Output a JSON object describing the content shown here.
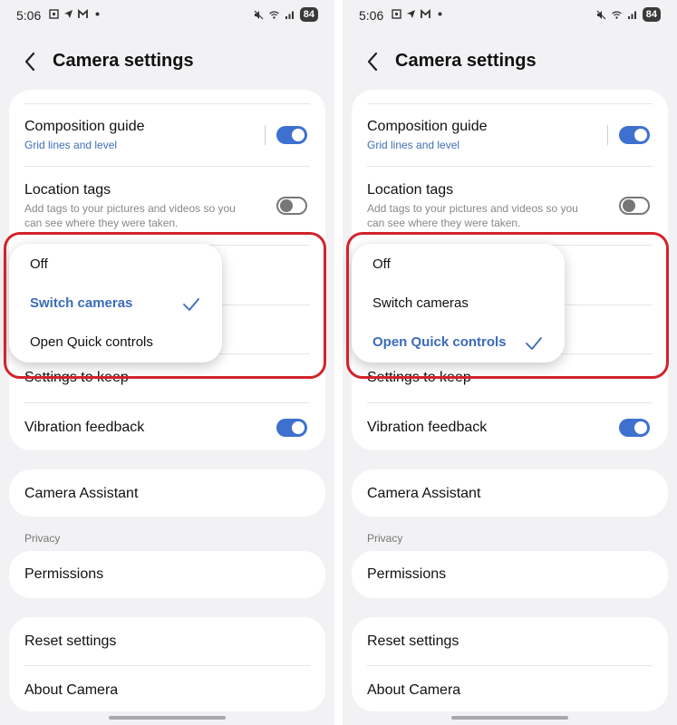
{
  "screens": [
    {
      "status": {
        "time": "5:06",
        "battery": "84"
      },
      "header": {
        "title": "Camera settings"
      },
      "settings": {
        "composition_title": "Composition guide",
        "composition_sub": "Grid lines and level",
        "composition_on": true,
        "location_title": "Location tags",
        "location_desc": "Add tags to your pictures and videos so you can see where they were taken.",
        "location_on": false,
        "keep_title": "Settings to keep",
        "vibration_title": "Vibration feedback",
        "vibration_on": true
      },
      "popup": {
        "options": [
          "Off",
          "Switch cameras",
          "Open Quick controls"
        ],
        "selected_index": 1
      },
      "assistant": "Camera Assistant",
      "privacy_label": "Privacy",
      "permissions": "Permissions",
      "reset": "Reset settings",
      "about": "About Camera"
    },
    {
      "status": {
        "time": "5:06",
        "battery": "84"
      },
      "header": {
        "title": "Camera settings"
      },
      "settings": {
        "composition_title": "Composition guide",
        "composition_sub": "Grid lines and level",
        "composition_on": true,
        "location_title": "Location tags",
        "location_desc": "Add tags to your pictures and videos so you can see where they were taken.",
        "location_on": false,
        "keep_title": "Settings to keep",
        "vibration_title": "Vibration feedback",
        "vibration_on": true
      },
      "popup": {
        "options": [
          "Off",
          "Switch cameras",
          "Open Quick controls"
        ],
        "selected_index": 2
      },
      "assistant": "Camera Assistant",
      "privacy_label": "Privacy",
      "permissions": "Permissions",
      "reset": "Reset settings",
      "about": "About Camera"
    }
  ],
  "colors": {
    "accent": "#3e71cf",
    "highlight_box": "#d1232a",
    "background": "#f2f2f4"
  }
}
